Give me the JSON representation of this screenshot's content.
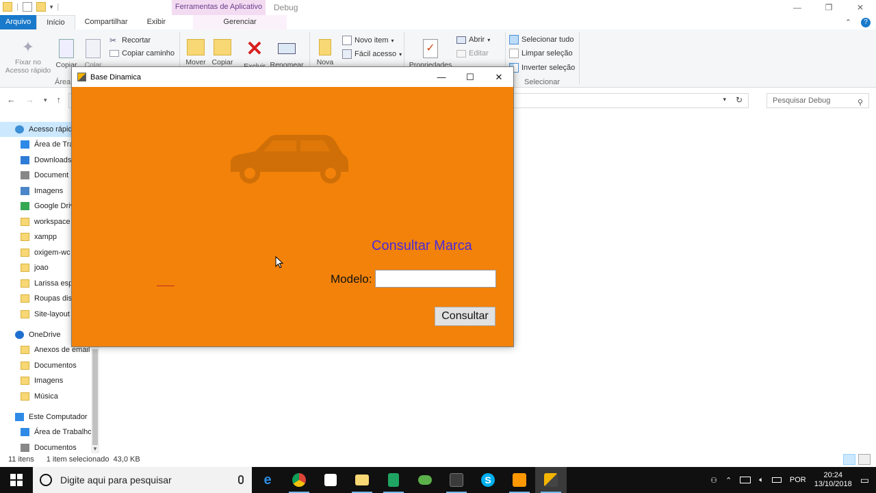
{
  "explorer": {
    "context_tab_title": "Ferramentas de Aplicativo",
    "window_title": "Debug",
    "tabs": {
      "file": "Arquivo",
      "home": "Início",
      "share": "Compartilhar",
      "view": "Exibir",
      "manage": "Gerenciar"
    },
    "ribbon": {
      "pin": "Fixar no\nAcesso rápido",
      "copy": "Copiar",
      "paste": "Colar",
      "cut": "Recortar",
      "copy_path": "Copiar caminho",
      "clipboard_group": "Área",
      "move": "Mover",
      "copy_to": "Copiar",
      "delete": "Excluir",
      "rename": "Renomear",
      "new_folder": "Nova",
      "new_item": "Novo item",
      "easy_access": "Fácil acesso",
      "properties": "Propriedades",
      "open": "Abrir",
      "edit": "Editar",
      "select_all": "Selecionar tudo",
      "select_none": "Limpar seleção",
      "invert_selection": "Inverter seleção",
      "select_group": "Selecionar"
    },
    "search_placeholder": "Pesquisar Debug",
    "nav_items": [
      {
        "label": "Acesso rápido",
        "icon": "star-icon"
      },
      {
        "label": "Área de Tra",
        "icon": "desktop-icon"
      },
      {
        "label": "Downloads",
        "icon": "download-icon"
      },
      {
        "label": "Document",
        "icon": "document-icon"
      },
      {
        "label": "Imagens",
        "icon": "pictures-icon"
      },
      {
        "label": "Google Driv",
        "icon": "google-drive-icon"
      },
      {
        "label": "workspace",
        "icon": "folder-icon"
      },
      {
        "label": "xampp",
        "icon": "folder-icon"
      },
      {
        "label": "oxigem-wc",
        "icon": "folder-icon"
      },
      {
        "label": "joao",
        "icon": "folder-icon"
      },
      {
        "label": "Larissa esp",
        "icon": "folder-icon"
      },
      {
        "label": "Roupas dis",
        "icon": "folder-icon"
      },
      {
        "label": "Site-layout",
        "icon": "folder-icon"
      },
      {
        "label": "OneDrive",
        "icon": "onedrive-icon"
      },
      {
        "label": "Anexos de email",
        "icon": "folder-icon"
      },
      {
        "label": "Documentos",
        "icon": "folder-icon"
      },
      {
        "label": "Imagens",
        "icon": "folder-icon"
      },
      {
        "label": "Música",
        "icon": "folder-icon"
      },
      {
        "label": "Este Computador",
        "icon": "computer-icon"
      },
      {
        "label": "Área de Trabalho",
        "icon": "desktop-icon"
      },
      {
        "label": "Documentos",
        "icon": "document-icon"
      }
    ],
    "status": {
      "item_count": "11 itens",
      "selection": "1 item selecionado  43,0 KB"
    }
  },
  "dialog": {
    "title": "Base Dinamica",
    "heading": "Consultar Marca",
    "model_label": "Modelo:",
    "model_value": "",
    "submit_label": "Consultar",
    "background_color": "#f28209",
    "heading_color": "#4b2ad8"
  },
  "taskbar": {
    "search_placeholder": "Digite aqui para pesquisar",
    "language": "POR",
    "time": "20:24",
    "date": "13/10/2018"
  }
}
